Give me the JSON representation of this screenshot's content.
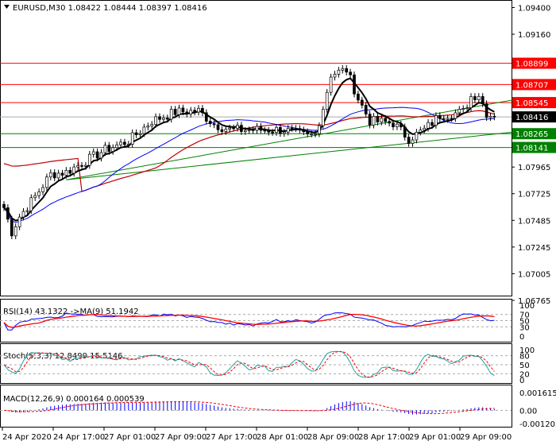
{
  "header": {
    "symbol": "EURUSD,M30",
    "ohlc": "1.08422 1.08444 1.08397 1.08416"
  },
  "chart_data": {
    "type": "candlestick",
    "title": "EURUSD,M30",
    "ylim": [
      1.067,
      1.0945
    ],
    "y_ticks": [
      "1.09400",
      "1.09160",
      "1.07965",
      "1.07725",
      "1.07485",
      "1.07245",
      "1.07005",
      "1.06765"
    ],
    "x_ticks": [
      "24 Apr 2020",
      "24 Apr 17:00",
      "27 Apr 01:00",
      "27 Apr 09:00",
      "27 Apr 17:00",
      "28 Apr 01:00",
      "28 Apr 09:00",
      "28 Apr 17:00",
      "29 Apr 01:00",
      "29 Apr 09:00"
    ],
    "price_keypoints": [
      [
        0,
        1.076
      ],
      [
        2,
        1.0738
      ],
      [
        4,
        1.0752
      ],
      [
        8,
        1.077
      ],
      [
        12,
        1.079
      ],
      [
        16,
        1.0792
      ],
      [
        20,
        1.08
      ],
      [
        26,
        1.0812
      ],
      [
        32,
        1.082
      ],
      [
        38,
        1.0838
      ],
      [
        44,
        1.0846
      ],
      [
        50,
        1.0847
      ],
      [
        54,
        1.0835
      ],
      [
        58,
        1.083
      ],
      [
        66,
        1.083
      ],
      [
        72,
        1.083
      ],
      [
        78,
        1.0824
      ],
      [
        80,
        1.0826
      ],
      [
        82,
        1.085
      ],
      [
        84,
        1.088
      ],
      [
        88,
        1.0884
      ],
      [
        91,
        1.0858
      ],
      [
        94,
        1.0838
      ],
      [
        100,
        1.0836
      ],
      [
        104,
        1.0822
      ],
      [
        108,
        1.083
      ],
      [
        112,
        1.0843
      ],
      [
        118,
        1.0846
      ],
      [
        120,
        1.086
      ],
      [
        122,
        1.0862
      ],
      [
        124,
        1.0845
      ],
      [
        126,
        1.0842
      ]
    ],
    "horizontal_levels": [
      {
        "price": "1.08899",
        "color": "#ff0000"
      },
      {
        "price": "1.08707",
        "color": "#ff0000"
      },
      {
        "price": "1.08545",
        "color": "#ff0000"
      },
      {
        "price": "1.08416",
        "color": "#000000"
      },
      {
        "price": "1.08265",
        "color": "#008000"
      },
      {
        "price": "1.08141",
        "color": "#008000"
      }
    ],
    "trendlines": [
      [
        [
          16,
          1.0785
        ],
        [
          131,
          1.0857
        ]
      ],
      [
        [
          16,
          1.0785
        ],
        [
          131,
          1.0828
        ]
      ]
    ],
    "indicators": {
      "rsi": {
        "label": "RSI(14) 43.1322  ->MA(9) 51.1942",
        "levels": [
          "100",
          "70",
          "50",
          "30",
          "0"
        ]
      },
      "stoch": {
        "label": "Stoch(5,3,3) 12.8499 15.5146",
        "levels": [
          "100",
          "80",
          "50",
          "20",
          "0"
        ]
      },
      "macd": {
        "label": "MACD(12,26,9) 0.000164 0.000539",
        "levels": [
          "0.001615",
          "0.00",
          "-0.001203"
        ]
      }
    }
  }
}
